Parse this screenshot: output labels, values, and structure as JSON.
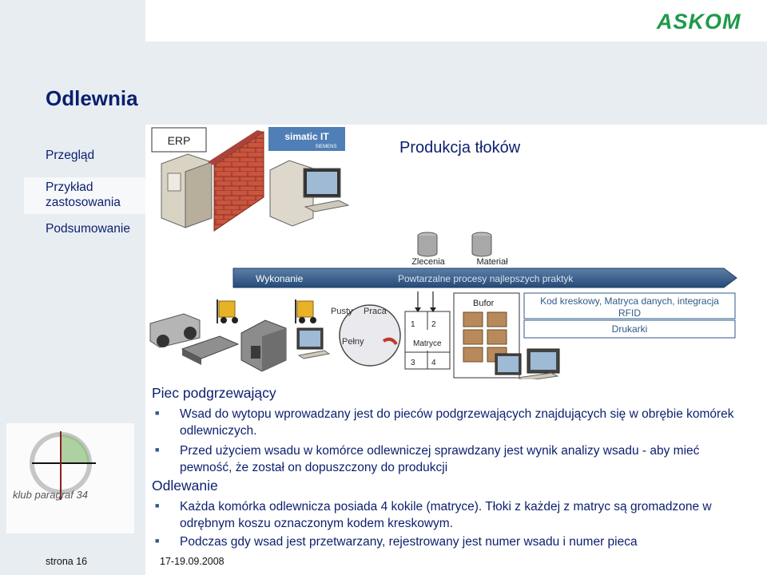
{
  "brand": {
    "logo_text": "ASKOM",
    "logo_color": "#1f9a4a"
  },
  "page_title": "Odlewnia",
  "nav": {
    "items": [
      {
        "label": "Przegląd"
      },
      {
        "label": "Przykład zastosowania",
        "active": true
      },
      {
        "label": "Podsumowanie"
      }
    ]
  },
  "diagram": {
    "erp_label": "ERP",
    "simatic_text": "simatic IT",
    "siemens_text": "SIEMENS",
    "heading": "Produkcja tłoków",
    "db_zlecenia": "Zlecenia",
    "db_material": "Materiał",
    "arrow_left": "Wykonanie",
    "arrow_right": "Powtarzalne procesy  najlepszych praktyk",
    "cycle_pusty": "Pusty",
    "cycle_praca": "Praca",
    "cycle_pelny": "Pełny",
    "matryce_label": "Matryce",
    "matryce_cells": [
      "1",
      "2",
      "3",
      "4"
    ],
    "bufor_label": "Bufor",
    "info_line1": "Kod kreskowy, Matryca danych, integracja",
    "info_line2": "RFID",
    "info_line3": "Drukarki"
  },
  "content": {
    "section1_title": "Piec podgrzewający",
    "bullet1": "Wsad do wytopu wprowadzany jest do pieców podgrzewających znajdujących się w obrębie komórek odlewniczych.",
    "bullet2": "Przed użyciem wsadu w komórce odlewniczej sprawdzany jest wynik analizy wsadu - aby mieć pewność, że został on dopuszczony do produkcji",
    "section2_title": "Odlewanie",
    "bullet3": "Każda komórka odlewnicza posiada 4 kokile (matryce). Tłoki z każdej z matryc są gromadzone w odrębnym koszu oznaczonym kodem kreskowym.",
    "bullet4": "Podczas gdy wsad jest przetwarzany, rejestrowany jest numer wsadu i numer pieca"
  },
  "klub_logo": {
    "text": "klub paragraf 34"
  },
  "footer": {
    "page": "strona 16",
    "date": "17-19.09.2008"
  }
}
